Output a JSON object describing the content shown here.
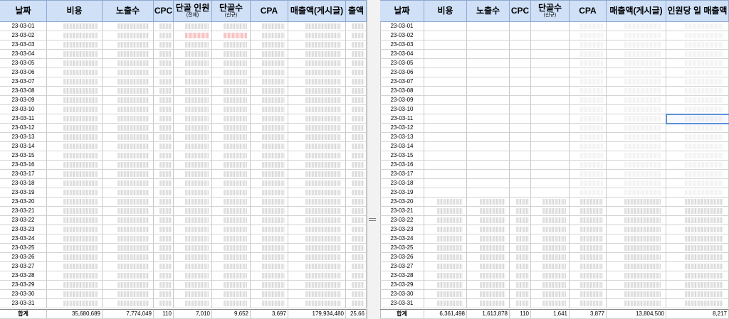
{
  "left_table": {
    "headers": [
      {
        "main": "날짜",
        "sub": ""
      },
      {
        "main": "비용",
        "sub": ""
      },
      {
        "main": "노출수",
        "sub": ""
      },
      {
        "main": "CPC",
        "sub": ""
      },
      {
        "main": "단골 인원",
        "sub": "(전체)"
      },
      {
        "main": "단골수",
        "sub": "(신규)"
      },
      {
        "main": "CPA",
        "sub": ""
      },
      {
        "main": "매출액(게시글)",
        "sub": ""
      },
      {
        "main": "출액",
        "sub": ""
      }
    ],
    "dates": [
      "23-03-01",
      "23-03-02",
      "23-03-03",
      "23-03-04",
      "23-03-05",
      "23-03-06",
      "23-03-07",
      "23-03-08",
      "23-03-09",
      "23-03-10",
      "23-03-11",
      "23-03-12",
      "23-03-13",
      "23-03-14",
      "23-03-15",
      "23-03-16",
      "23-03-17",
      "23-03-18",
      "23-03-19",
      "23-03-20",
      "23-03-21",
      "23-03-22",
      "23-03-23",
      "23-03-24",
      "23-03-25",
      "23-03-26",
      "23-03-27",
      "23-03-28",
      "23-03-29",
      "23-03-30",
      "23-03-31"
    ],
    "total_label": "합계",
    "totals": [
      "35,680,689",
      "7,774,049",
      "110",
      "7,010",
      "9,652",
      "3,697",
      "179,934,480",
      "25,66"
    ]
  },
  "right_table": {
    "headers": [
      {
        "main": "날짜",
        "sub": ""
      },
      {
        "main": "비용",
        "sub": ""
      },
      {
        "main": "노출수",
        "sub": ""
      },
      {
        "main": "CPC",
        "sub": ""
      },
      {
        "main": "단골수",
        "sub": "(신규)"
      },
      {
        "main": "CPA",
        "sub": ""
      },
      {
        "main": "매출액(게시글)",
        "sub": ""
      },
      {
        "main": "인원당 일 매출액",
        "sub": ""
      }
    ],
    "dates": [
      "23-03-01",
      "23-03-02",
      "23-03-03",
      "23-03-04",
      "23-03-05",
      "23-03-06",
      "23-03-07",
      "23-03-08",
      "23-03-09",
      "23-03-10",
      "23-03-11",
      "23-03-12",
      "23-03-13",
      "23-03-14",
      "23-03-15",
      "23-03-16",
      "23-03-17",
      "23-03-18",
      "23-03-19",
      "23-03-20",
      "23-03-21",
      "23-03-22",
      "23-03-23",
      "23-03-24",
      "23-03-25",
      "23-03-26",
      "23-03-27",
      "23-03-28",
      "23-03-29",
      "23-03-30",
      "23-03-31"
    ],
    "total_label": "합계",
    "totals": [
      "6,361,498",
      "1,613,878",
      "110",
      "1,641",
      "3,877",
      "13,804,500",
      "8,217"
    ]
  },
  "colors": {
    "header_bg": "#cfe0f7",
    "selection": "#5b8fd6",
    "highlight_red": "#f3b9b9"
  }
}
